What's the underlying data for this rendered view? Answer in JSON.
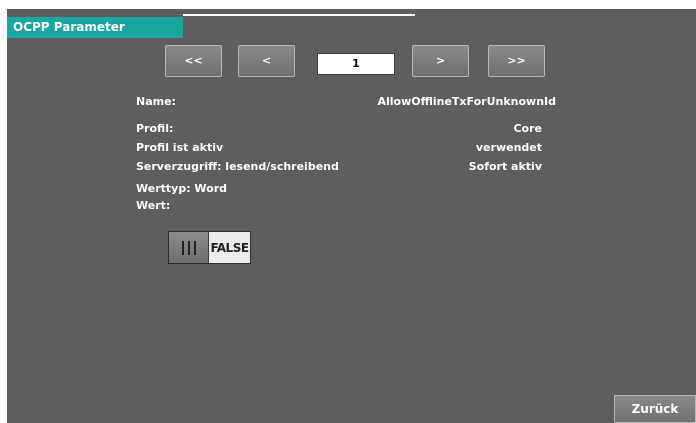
{
  "title": "OCPP Parameter",
  "nav": {
    "first": "<<",
    "prev": "<",
    "page": "1",
    "next": ">",
    "last": ">>"
  },
  "fields": {
    "name_label": "Name:",
    "name_value": "AllowOfflineTxForUnknownId",
    "profil_label": "Profil:",
    "profil_value": "Core",
    "profil_aktiv_label": "Profil ist aktiv",
    "profil_aktiv_value": "verwendet",
    "serverzugriff_label": "Serverzugriff: lesend/schreibend",
    "serverzugriff_value": "Sofort aktiv",
    "werttyp_label": "Werttyp: Word",
    "wert_label": "Wert:"
  },
  "toggle": {
    "value": "FALSE"
  },
  "back_button": "Zurück",
  "colors": {
    "background": "#5e5e5e",
    "title_accent": "#1aa7a1",
    "button": "#7c7c7c"
  }
}
